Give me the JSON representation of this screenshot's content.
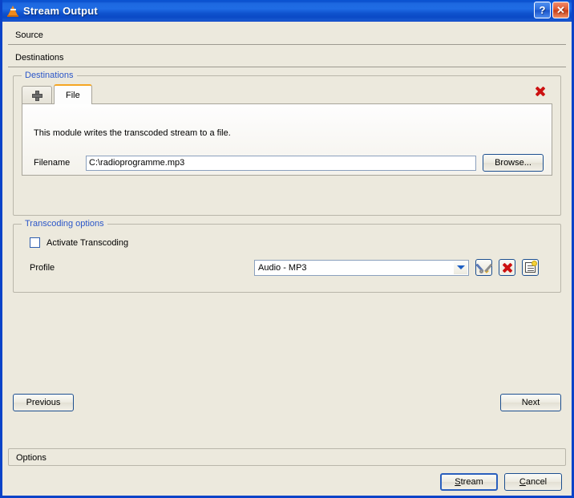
{
  "window": {
    "title": "Stream Output",
    "app_icon": "vlc-cone-icon",
    "help_label": "?",
    "close_label": "✕"
  },
  "sections": {
    "source_label": "Source",
    "destinations_label": "Destinations",
    "options_label": "Options"
  },
  "destinations_group": {
    "title": "Destinations",
    "add_tab_icon": "plus-icon",
    "remove_icon": "close-x-icon",
    "tabs": [
      {
        "label": "File",
        "selected": true
      }
    ],
    "module_description": "This module writes the transcoded stream to a file.",
    "filename_label": "Filename",
    "filename_value": "C:\\radioprogramme.mp3",
    "browse_label": "Browse..."
  },
  "transcoding_group": {
    "title": "Transcoding options",
    "activate_label": "Activate Transcoding",
    "activate_checked": false,
    "profile_label": "Profile",
    "profile_value": "Audio - MP3",
    "profile_options": [
      "Audio - MP3"
    ],
    "edit_profile_icon": "tools-icon",
    "delete_profile_icon": "delete-x-icon",
    "new_profile_icon": "new-profile-icon"
  },
  "navigation": {
    "previous_label": "Previous",
    "next_label": "Next"
  },
  "dialog_buttons": {
    "stream_accel": "S",
    "stream_rest": "tream",
    "cancel_accel": "C",
    "cancel_rest": "ancel"
  },
  "colors": {
    "title_bar_blue": "#1f6ce4",
    "dialog_bg": "#ece9dd",
    "group_title_blue": "#2b56c8",
    "tab_accent_orange": "#f5a623",
    "delete_red": "#cc1111"
  }
}
